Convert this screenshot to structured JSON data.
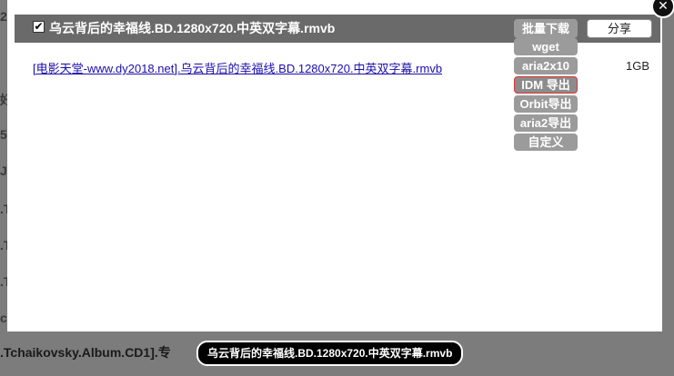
{
  "background": {
    "left_fragments": [
      "20",
      "好",
      "5",
      "J",
      ".T",
      ".T",
      ".T",
      "ct"
    ],
    "bottom_text": ".Tchaikovsky.Album.CD1].专"
  },
  "modal": {
    "header": {
      "checkbox_checked": true,
      "checkbox_glyph": "✔",
      "title": "乌云背后的幸福线.BD.1280x720.中英双字幕.rmvb",
      "batch_download_label": "批量下载",
      "share_label": "分享"
    },
    "file": {
      "link_text": "[电影天堂-www.dy2018.net].乌云背后的幸福线.BD.1280x720.中英双字幕.rmvb",
      "size": "1GB"
    },
    "download_menu": {
      "items": [
        {
          "label": "wget"
        },
        {
          "label": "aria2x10"
        },
        {
          "label": "IDM 导出"
        },
        {
          "label": "Orbit导出"
        },
        {
          "label": "aria2导出"
        },
        {
          "label": "自定义"
        }
      ],
      "highlighted_item": "IDM 导出"
    },
    "close_glyph": "✕"
  },
  "tooltip": {
    "text": "乌云背后的幸福线.BD.1280x720.中英双字幕.rmvb"
  }
}
